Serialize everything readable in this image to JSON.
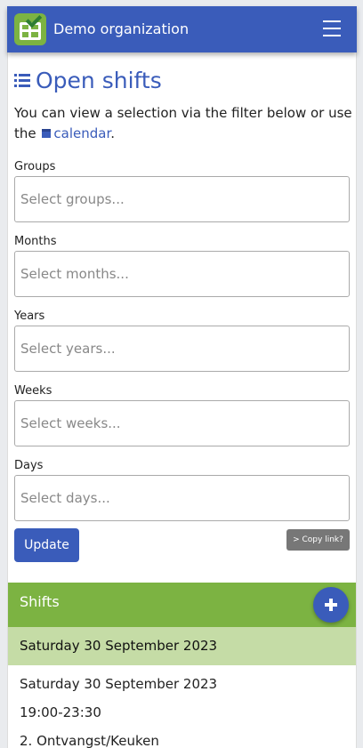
{
  "header": {
    "brand": "Demo organization",
    "logo_icon": "calendar-check-icon",
    "menu_icon": "hamburger-icon"
  },
  "page": {
    "title": "Open shifts",
    "title_icon": "list-icon",
    "intro_text": "You can view a selection via the filter below or use the",
    "calendar_link": "calendar",
    "intro_end": "."
  },
  "filters": {
    "groups": {
      "label": "Groups",
      "placeholder": "Select groups..."
    },
    "months": {
      "label": "Months",
      "placeholder": "Select months..."
    },
    "years": {
      "label": "Years",
      "placeholder": "Select years..."
    },
    "weeks": {
      "label": "Weeks",
      "placeholder": "Select weeks..."
    },
    "days": {
      "label": "Days",
      "placeholder": "Select days..."
    }
  },
  "buttons": {
    "update": "Update",
    "copy_link": "Copy link?"
  },
  "shifts": {
    "header": "Shifts",
    "day_header": "Saturday 30 September 2023",
    "entry": {
      "date": "Saturday 30 September 2023",
      "time": "19:00-23:30",
      "location": "2. Ontvangst/Keuken"
    }
  },
  "colors": {
    "primary": "#3a5cba",
    "green": "#7cb342",
    "light_green": "#c5dca6"
  }
}
